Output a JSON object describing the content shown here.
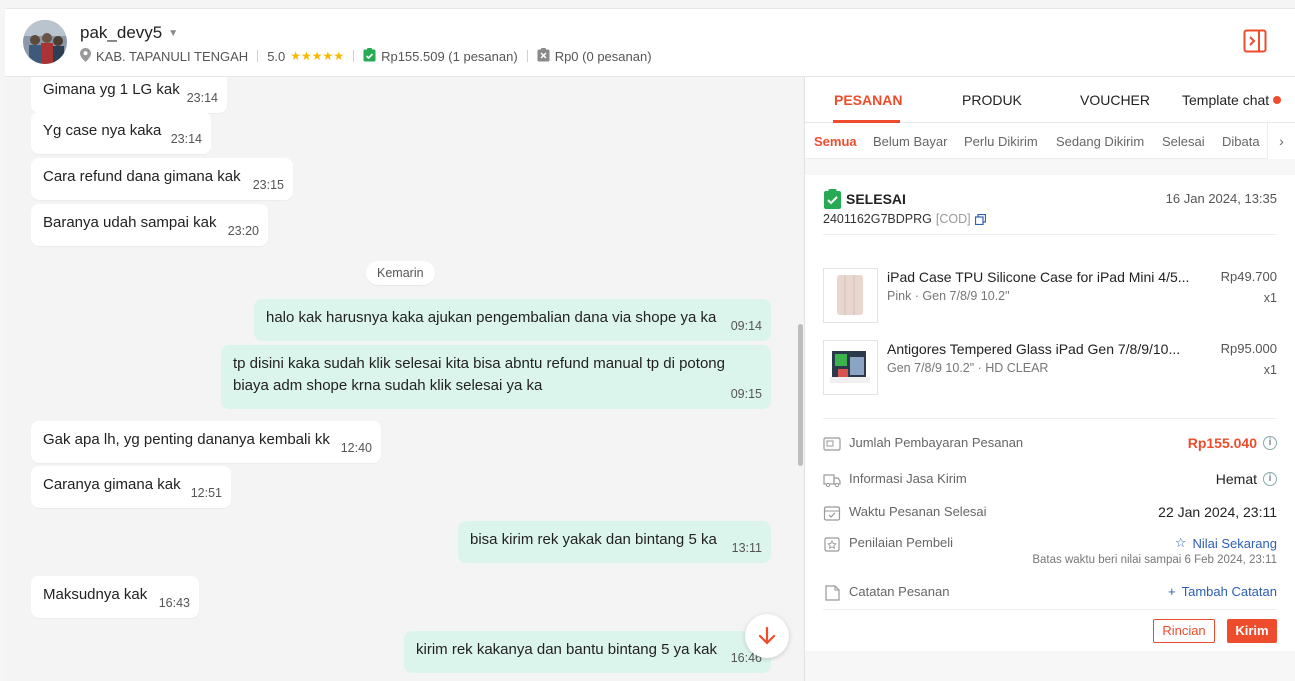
{
  "header": {
    "username": "pak_devy5",
    "location": "KAB. TAPANULI TENGAH",
    "rating": "5.0",
    "stars": "★★★★★",
    "paid_total": "Rp155.509 (1 pesanan)",
    "unpaid_total": "Rp0 (0 pesanan)"
  },
  "chat": {
    "day_divider": "Kemarin",
    "messages": [
      {
        "text": "Gimana yg 1 LG kak",
        "time": "23:14"
      },
      {
        "text": "Yg case nya kaka",
        "time": "23:14"
      },
      {
        "text": "Cara refund dana gimana kak",
        "time": "23:15"
      },
      {
        "text": "Baranya udah sampai kak",
        "time": "23:20"
      },
      {
        "text": "halo kak harusnya kaka ajukan pengembalian dana via shope ya ka",
        "time": "09:14"
      },
      {
        "text": "tp disini kaka sudah klik selesai kita bisa abntu refund manual tp di potong biaya adm shope krna sudah klik selesai ya ka",
        "time": "09:15"
      },
      {
        "text": "Gak apa lh, yg penting dananya kembali kk",
        "time": "12:40"
      },
      {
        "text": "Caranya gimana kak",
        "time": "12:51"
      },
      {
        "text": "bisa kirim rek yakak dan bintang 5 ka",
        "time": "13:11"
      },
      {
        "text": "Maksudnya kak",
        "time": "16:43"
      },
      {
        "text": "kirim rek kakanya dan bantu bintang 5 ya kak",
        "time": "16:46"
      }
    ]
  },
  "panel": {
    "tabs": [
      "PESANAN",
      "PRODUK",
      "VOUCHER",
      "Template chat"
    ],
    "subtabs": [
      "Semua",
      "Belum Bayar",
      "Perlu Dikirim",
      "Sedang Dikirim",
      "Selesai",
      "Dibata"
    ],
    "order": {
      "status": "SELESAI",
      "date": "16 Jan 2024, 13:35",
      "id": "2401162G7BDPRG",
      "payment": "[COD]",
      "products": [
        {
          "name": "iPad Case TPU Silicone Case for iPad Mini 4/5...",
          "variant": "Pink · Gen 7/8/9 10.2\"",
          "price": "Rp49.700",
          "qty": "x1"
        },
        {
          "name": "Antigores Tempered Glass iPad Gen 7/8/9/10...",
          "variant": "Gen 7/8/9 10.2\" · HD CLEAR",
          "price": "Rp95.000",
          "qty": "x1"
        }
      ],
      "payment_label": "Jumlah Pembayaran Pesanan",
      "payment_value": "Rp155.040",
      "shipping_label": "Informasi Jasa Kirim",
      "shipping_value": "Hemat",
      "completed_label": "Waktu Pesanan Selesai",
      "completed_value": "22 Jan 2024, 23:11",
      "review_label": "Penilaian Pembeli",
      "review_link": "Nilai Sekarang",
      "review_note": "Batas waktu beri nilai sampai 6 Feb 2024, 23:11",
      "note_label": "Catatan Pesanan",
      "note_link": "Tambah Catatan",
      "btn_detail": "Rincian",
      "btn_send": "Kirim"
    }
  },
  "colors": {
    "accent": "#ee4d2d",
    "outgoing": "#dcf5ec",
    "link": "#2c5fb5"
  }
}
